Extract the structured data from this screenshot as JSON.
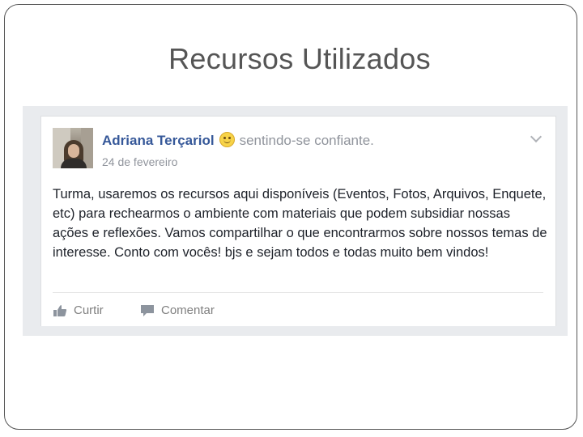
{
  "slide": {
    "title": "Recursos Utilizados"
  },
  "post": {
    "author_name": "Adriana Terçariol",
    "feeling_emoji_icon": "smiley-face-icon",
    "feeling_text": "sentindo-se confiante.",
    "date": "24 de fevereiro",
    "menu_icon": "chevron-down-icon",
    "body_text": "Turma, usaremos os recursos aqui disponíveis (Eventos, Fotos, Arquivos, Enquete, etc) para rechearmos o ambiente com materiais que podem subsidiar nossas ações e reflexões. Vamos compartilhar o que encontrarmos sobre nossos temas de interesse. Conto com vocês! bjs e sejam todos e todas muito bem vindos!",
    "actions": {
      "like_label": "Curtir",
      "like_icon": "thumbs-up-icon",
      "comment_label": "Comentar",
      "comment_icon": "speech-bubble-icon"
    }
  },
  "colors": {
    "author_link": "#365899",
    "secondary_text": "#90949c",
    "feed_background": "#e9ebee"
  }
}
